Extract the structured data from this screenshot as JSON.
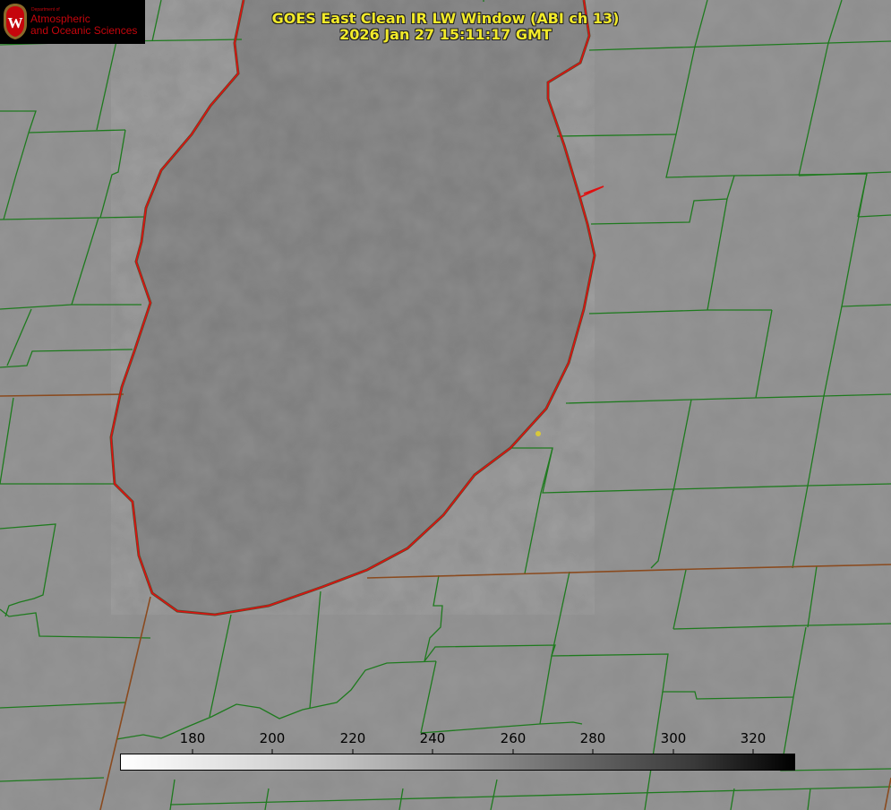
{
  "title": {
    "line1": "GOES East Clean IR LW Window (ABI ch 13)",
    "line2": "2026 Jan 27 15:11:17 GMT"
  },
  "logo": {
    "department": "Department of",
    "line1": "Atmospheric",
    "line2": "and Oceanic Sciences"
  },
  "colorbar": {
    "ticks": [
      "180",
      "200",
      "220",
      "240",
      "260",
      "280",
      "300",
      "320"
    ]
  },
  "colors": {
    "county_borders": "#1e7a1e",
    "state_borders": "#8a4a1e",
    "lake_outline": "#e01010",
    "title_text": "#f2ea2a",
    "marker": "#d8c83a"
  }
}
